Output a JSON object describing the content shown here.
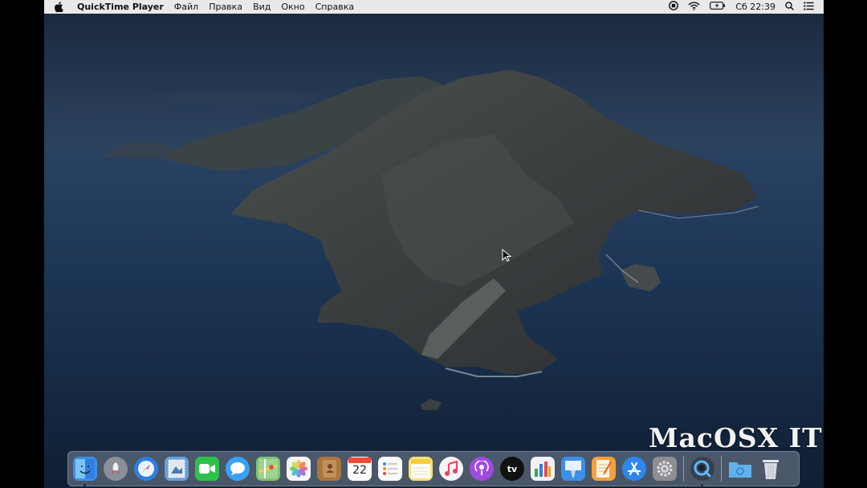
{
  "menubar": {
    "app_name": "QuickTime Player",
    "menus": [
      "Файл",
      "Правка",
      "Вид",
      "Окно",
      "Справка"
    ],
    "clock": "Сб 22:39"
  },
  "dock": {
    "apps": [
      {
        "id": "finder",
        "icon": "finder-icon",
        "color": "#3f8fe6",
        "running": true
      },
      {
        "id": "launchpad",
        "icon": "rocket-icon",
        "color": "#8a8f99",
        "running": false
      },
      {
        "id": "safari",
        "icon": "compass-icon",
        "color": "#2f7fe0",
        "running": false
      },
      {
        "id": "mail-stamp",
        "icon": "stamp-icon",
        "color": "#6aa0d8",
        "running": false
      },
      {
        "id": "facetime",
        "icon": "camera-icon",
        "color": "#2dc24c",
        "running": false
      },
      {
        "id": "messages",
        "icon": "speech-bubble-icon",
        "color": "#3aa2f5",
        "running": false
      },
      {
        "id": "maps",
        "icon": "map-icon",
        "color": "#7cc576",
        "running": false
      },
      {
        "id": "photos",
        "icon": "flower-icon",
        "color": "#f4f4f4",
        "running": false
      },
      {
        "id": "contacts",
        "icon": "address-book-icon",
        "color": "#a6773e",
        "running": false
      },
      {
        "id": "calendar",
        "icon": "calendar-icon",
        "color": "#ffffff",
        "running": false,
        "label": "22"
      },
      {
        "id": "reminders",
        "icon": "checklist-icon",
        "color": "#fafafa",
        "running": false
      },
      {
        "id": "notes",
        "icon": "notepad-icon",
        "color": "#f8e27a",
        "running": false
      },
      {
        "id": "music",
        "icon": "music-note-icon",
        "color": "#f5f5f5",
        "running": false
      },
      {
        "id": "podcasts",
        "icon": "podcast-icon",
        "color": "#a04be0",
        "running": false
      },
      {
        "id": "tv",
        "icon": "apple-tv-icon",
        "color": "#111111",
        "running": false,
        "label": "tv"
      },
      {
        "id": "numbers",
        "icon": "bar-chart-icon",
        "color": "#f2f2f2",
        "running": false
      },
      {
        "id": "keynote",
        "icon": "lectern-icon",
        "color": "#3d8fe8",
        "running": false
      },
      {
        "id": "pages",
        "icon": "pen-document-icon",
        "color": "#f7a03a",
        "running": false
      },
      {
        "id": "app-store",
        "icon": "app-store-icon",
        "color": "#2e86ef",
        "running": false
      },
      {
        "id": "system-preferences",
        "icon": "gear-icon",
        "color": "#8e8e93",
        "running": false
      }
    ],
    "running_apps": [
      {
        "id": "quicktime",
        "icon": "quicktime-icon",
        "color": "#3a3f4a",
        "running": true
      }
    ],
    "stack_items": [
      {
        "id": "downloads",
        "icon": "folder-icon",
        "color": "#5fb3ea"
      },
      {
        "id": "trash",
        "icon": "trash-icon",
        "color": "#d9dde3"
      }
    ]
  },
  "watermark": "MacOSX IT"
}
